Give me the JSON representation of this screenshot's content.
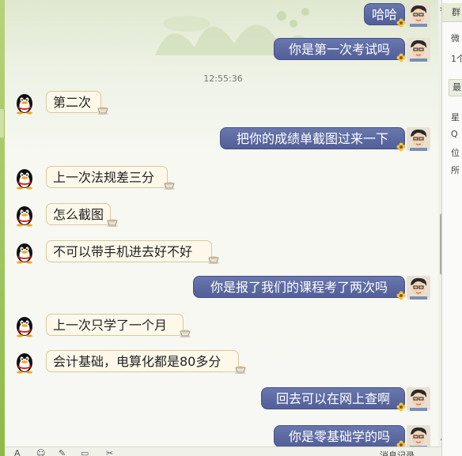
{
  "timestamp": "12:55:36",
  "messages": [
    {
      "side": "out",
      "text": "哈哈"
    },
    {
      "side": "out",
      "text": "你是第一次考试吗"
    },
    {
      "side": "in",
      "text": "第二次"
    },
    {
      "side": "out",
      "text": "把你的成绩单截图过来一下"
    },
    {
      "side": "in",
      "text": "上一次法规差三分"
    },
    {
      "side": "in",
      "text": "怎么截图"
    },
    {
      "side": "in",
      "text": "不可以带手机进去好不好"
    },
    {
      "side": "out",
      "text": "你是报了我们的课程考了两次吗"
    },
    {
      "side": "in",
      "text": "上一次只学了一个月"
    },
    {
      "side": "in",
      "text": "会计基础，电算化都是80多分"
    },
    {
      "side": "out",
      "text": "回去可以在网上查啊"
    },
    {
      "side": "out",
      "text": "你是零基础学的吗"
    }
  ],
  "side_panel": {
    "tab_label": "群",
    "line1": "微",
    "line2": "1个",
    "tab2_label": "最",
    "line3": "星",
    "line4": "Q",
    "line5": "位",
    "line6": "所"
  },
  "toolbar": {
    "history_label": "消息记录"
  },
  "colors": {
    "outgoing_bubble": "#5b67a0",
    "incoming_bubble": "#fdf8ea",
    "incoming_border": "#d9c89f"
  },
  "icons": {
    "incoming_avatar": "qq-penguin-icon",
    "outgoing_avatar": "user-photo-avatar",
    "bubble_decoration": "teacup-icon",
    "outgoing_decoration": "flower-icon"
  }
}
